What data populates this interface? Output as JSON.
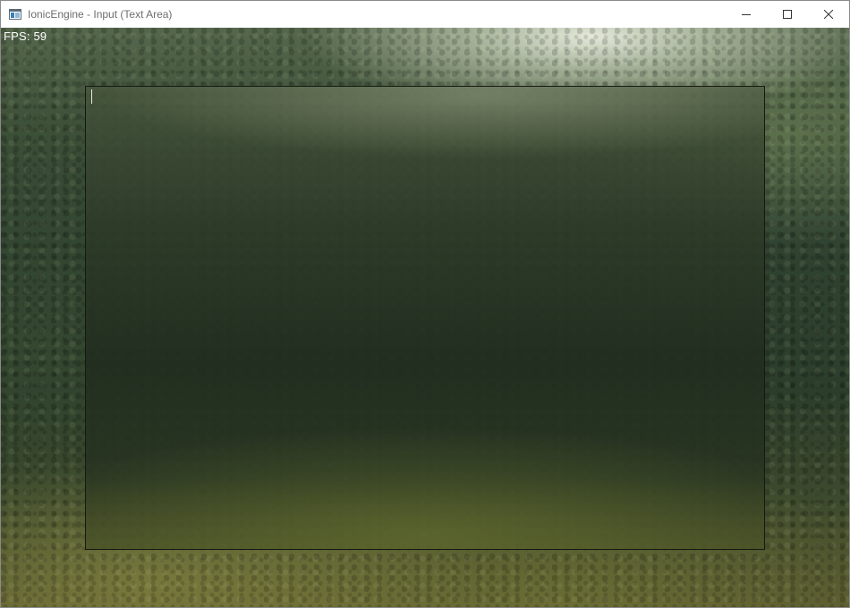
{
  "window": {
    "title": "IonicEngine - Input (Text Area)",
    "controls": {
      "minimize_icon": "minimize-icon",
      "maximize_icon": "maximize-icon",
      "close_icon": "close-icon"
    }
  },
  "overlay": {
    "fps_text": "FPS: 59"
  },
  "text_area": {
    "value": ""
  },
  "colors": {
    "titlebar_bg": "#ffffff",
    "title_text": "#6d6d6d",
    "fps_text": "#ffffff",
    "textarea_border": "#141a12"
  }
}
